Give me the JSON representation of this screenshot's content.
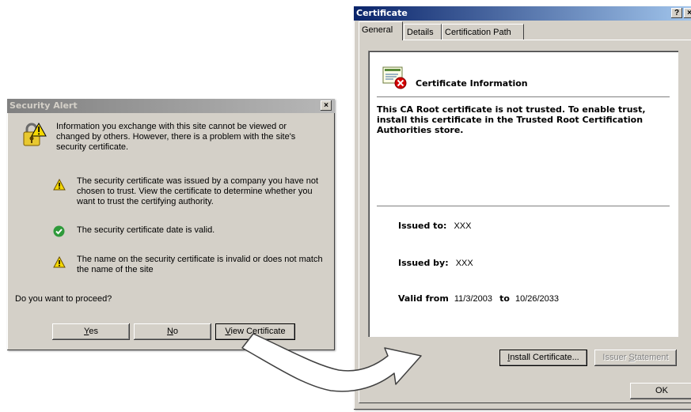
{
  "security_alert": {
    "title": "Security Alert",
    "close": "×",
    "intro": "Information you exchange with this site cannot be viewed or changed by others. However, there is a problem with the site's security certificate.",
    "items": [
      {
        "icon": "warning-icon",
        "text": "The security certificate was issued by a company you have not chosen to trust. View the certificate to determine whether you want to trust the certifying authority."
      },
      {
        "icon": "check-icon",
        "text": "The security certificate date is valid."
      },
      {
        "icon": "warning-icon",
        "text": "The name on the security certificate is invalid or does not match the name of the site"
      }
    ],
    "question": "Do you want to proceed?",
    "buttons": {
      "yes_u": "Y",
      "yes_rest": "es",
      "no_u": "N",
      "no_rest": "o",
      "view_u": "V",
      "view_rest": "iew Certificate"
    }
  },
  "certificate": {
    "title": "Certificate",
    "help": "?",
    "close": "×",
    "tabs": [
      "General",
      "Details",
      "Certification Path"
    ],
    "info_heading": "Certificate Information",
    "message": "This CA Root certificate is not trusted. To enable trust, install this certificate in the Trusted Root Certification Authorities store.",
    "issued_to_label": "Issued to:",
    "issued_to_value": "XXX",
    "issued_by_label": "Issued by:",
    "issued_by_value": "XXX",
    "valid_from_label": "Valid from",
    "valid_from": "11/3/2003",
    "to_label": "to",
    "valid_to": "10/26/2033",
    "install_u": "I",
    "install_rest": "nstall Certificate...",
    "issuer_pre": "Issuer ",
    "issuer_u": "S",
    "issuer_rest": "tatement",
    "ok": "OK"
  },
  "colors": {
    "dialog_bg": "#d4d0c8",
    "warning": "#f5d800",
    "check": "#2e9a3a",
    "error": "#d40000"
  }
}
